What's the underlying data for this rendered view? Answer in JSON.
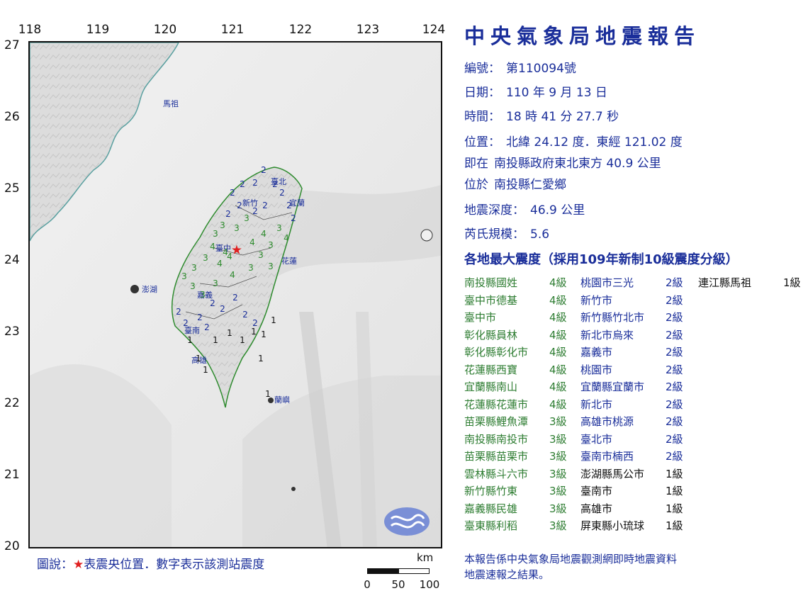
{
  "map": {
    "lon_ticks": [
      "118",
      "119",
      "120",
      "121",
      "122",
      "123",
      "124"
    ],
    "lat_ticks": [
      "27",
      "26",
      "25",
      "24",
      "23",
      "22",
      "21",
      "20"
    ],
    "places": [
      "馬祖",
      "臺北",
      "新竹",
      "宜蘭",
      "臺中",
      "花蓮",
      "澎湖",
      "嘉義",
      "臺南",
      "高雄",
      "蘭嶼"
    ],
    "intensities": [
      "2",
      "2",
      "2",
      "2",
      "2",
      "2",
      "2",
      "2",
      "2",
      "2",
      "2",
      "2",
      "3",
      "3",
      "3",
      "3",
      "4",
      "4",
      "4",
      "4",
      "4",
      "4",
      "3",
      "3",
      "4",
      "3",
      "3",
      "3",
      "4",
      "3",
      "3",
      "3",
      "3",
      "3",
      "3",
      "2",
      "2",
      "2",
      "2",
      "2",
      "2",
      "2",
      "2",
      "2",
      "1",
      "1",
      "1",
      "1",
      "1",
      "1",
      "1",
      "1",
      "1",
      "1",
      "1"
    ],
    "colors": {
      "intensity_4": "#2e8b2e",
      "intensity_3": "#2e8b2e",
      "intensity_2": "#1a2e9a",
      "intensity_1": "#111111",
      "epicenter": "#e02020",
      "logo": "#7a8fd6"
    }
  },
  "legend": {
    "prefix": "圖說：",
    "star": "★",
    "text": "表震央位置．數字表示該測站震度"
  },
  "scale": {
    "unit": "km",
    "labels": [
      "0",
      "50",
      "100"
    ]
  },
  "report": {
    "title": "中央氣象局地震報告",
    "number_label": "編號：",
    "number": "第110094號",
    "date_label": "日期：",
    "date": "110 年 9 月 13 日",
    "time_label": "時間：",
    "time": "18 時 41 分 27.7 秒",
    "location_label": "位置：",
    "location": "北緯 24.12 度．東經 121.02 度",
    "near_label": "即在",
    "near": "南投縣政府東北東方 40.9 公里",
    "at_label": "位於",
    "at": "南投縣仁愛鄉",
    "depth_label": "地震深度：",
    "depth": "46.9 公里",
    "magnitude_label": "芮氏規模：",
    "magnitude": "5.6",
    "grid_title": "各地最大震度（採用109年新制10級震度分級）",
    "col1": [
      {
        "name": "南投縣國姓",
        "level": "4級"
      },
      {
        "name": "臺中市德基",
        "level": "4級"
      },
      {
        "name": "臺中市",
        "level": "4級"
      },
      {
        "name": "彰化縣員林",
        "level": "4級"
      },
      {
        "name": "彰化縣彰化市",
        "level": "4級"
      },
      {
        "name": "花蓮縣西寶",
        "level": "4級"
      },
      {
        "name": "宜蘭縣南山",
        "level": "4級"
      },
      {
        "name": "花蓮縣花蓮市",
        "level": "4級"
      },
      {
        "name": "苗栗縣鯉魚潭",
        "level": "3級"
      },
      {
        "name": "南投縣南投市",
        "level": "3級"
      },
      {
        "name": "苗栗縣苗栗市",
        "level": "3級"
      },
      {
        "name": "雲林縣斗六市",
        "level": "3級"
      },
      {
        "name": "新竹縣竹東",
        "level": "3級"
      },
      {
        "name": "嘉義縣民雄",
        "level": "3級"
      },
      {
        "name": "臺東縣利稻",
        "level": "3級"
      }
    ],
    "col2": [
      {
        "name": "桃園市三光",
        "level": "2級"
      },
      {
        "name": "新竹市",
        "level": "2級"
      },
      {
        "name": "新竹縣竹北市",
        "level": "2級"
      },
      {
        "name": "新北市烏來",
        "level": "2級"
      },
      {
        "name": "嘉義市",
        "level": "2級"
      },
      {
        "name": "桃園市",
        "level": "2級"
      },
      {
        "name": "宜蘭縣宜蘭市",
        "level": "2級"
      },
      {
        "name": "新北市",
        "level": "2級"
      },
      {
        "name": "高雄市桃源",
        "level": "2級"
      },
      {
        "name": "臺北市",
        "level": "2級"
      },
      {
        "name": "臺南市楠西",
        "level": "2級"
      },
      {
        "name": "澎湖縣馬公市",
        "level": "1級"
      },
      {
        "name": "臺南市",
        "level": "1級"
      },
      {
        "name": "高雄市",
        "level": "1級"
      },
      {
        "name": "屏東縣小琉球",
        "level": "1級"
      }
    ],
    "col3": [
      {
        "name": "連江縣馬祖",
        "level": "1級"
      }
    ],
    "footer_line1": "本報告係中央氣象局地震觀測網即時地震資料",
    "footer_line2": "地震速報之結果。"
  }
}
